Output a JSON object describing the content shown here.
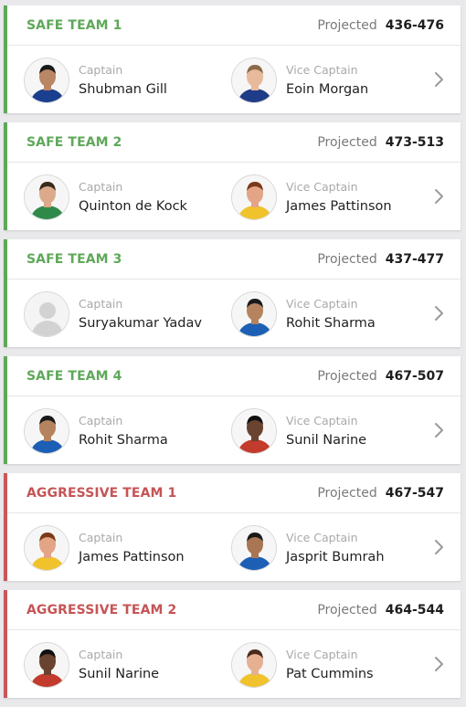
{
  "labels": {
    "captain": "Captain",
    "vice_captain": "Vice Captain",
    "projected": "Projected"
  },
  "colors": {
    "safe_accent": "#5fa85a",
    "aggressive_accent": "#c55456",
    "background": "#e9e9ec"
  },
  "icons": {
    "open": "chevron-right-icon",
    "player": "player-avatar-icon"
  },
  "teams": [
    {
      "name": "SAFE TEAM 1",
      "type": "safe",
      "projected": "436-476",
      "captain": {
        "name": "Shubman Gill",
        "kit": "#1b3f8f",
        "skin": "#b98763",
        "hair": "#1a1a1a"
      },
      "vice_captain": {
        "name": "Eoin Morgan",
        "kit": "#1f3c88",
        "skin": "#e8b99b",
        "hair": "#8b6a4a"
      }
    },
    {
      "name": "SAFE TEAM 2",
      "type": "safe",
      "projected": "473-513",
      "captain": {
        "name": "Quinton de Kock",
        "kit": "#2f8a4a",
        "skin": "#dca98a",
        "hair": "#3a2a1a"
      },
      "vice_captain": {
        "name": "James Pattinson",
        "kit": "#f0c22c",
        "skin": "#e3a585",
        "hair": "#7a3a1a"
      }
    },
    {
      "name": "SAFE TEAM 3",
      "type": "safe",
      "projected": "437-477",
      "captain": {
        "name": "Suryakumar Yadav",
        "kit": "#c9c9c9",
        "skin": "#d9d9d9",
        "hair": "#d9d9d9",
        "placeholder": true
      },
      "vice_captain": {
        "name": "Rohit Sharma",
        "kit": "#1c5fb5",
        "skin": "#b5835e",
        "hair": "#1a1a1a"
      }
    },
    {
      "name": "SAFE TEAM 4",
      "type": "safe",
      "projected": "467-507",
      "captain": {
        "name": "Rohit Sharma",
        "kit": "#1c5fb5",
        "skin": "#b5835e",
        "hair": "#1a1a1a"
      },
      "vice_captain": {
        "name": "Sunil Narine",
        "kit": "#c23b2c",
        "skin": "#6a4330",
        "hair": "#111111"
      }
    },
    {
      "name": "AGGRESSIVE TEAM 1",
      "type": "aggressive",
      "projected": "467-547",
      "captain": {
        "name": "James Pattinson",
        "kit": "#f0c22c",
        "skin": "#e3a585",
        "hair": "#7a3a1a"
      },
      "vice_captain": {
        "name": "Jasprit Bumrah",
        "kit": "#1c5fb5",
        "skin": "#a97552",
        "hair": "#1a1a1a"
      }
    },
    {
      "name": "AGGRESSIVE TEAM 2",
      "type": "aggressive",
      "projected": "464-544",
      "captain": {
        "name": "Sunil Narine",
        "kit": "#c23b2c",
        "skin": "#6a4330",
        "hair": "#111111"
      },
      "vice_captain": {
        "name": "Pat Cummins",
        "kit": "#f0c22c",
        "skin": "#e6b092",
        "hair": "#4a2a1a"
      }
    }
  ]
}
